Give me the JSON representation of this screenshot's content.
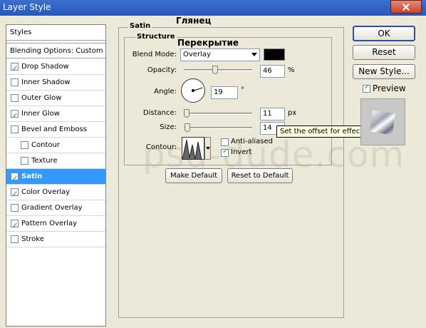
{
  "window": {
    "title": "Layer Style"
  },
  "sidebar": {
    "styles_header": "Styles",
    "blending_options": "Blending Options: Custom",
    "items": [
      {
        "label": "Drop Shadow",
        "checked": true,
        "sub": false,
        "selected": false
      },
      {
        "label": "Inner Shadow",
        "checked": false,
        "sub": false,
        "selected": false
      },
      {
        "label": "Outer Glow",
        "checked": false,
        "sub": false,
        "selected": false
      },
      {
        "label": "Inner Glow",
        "checked": true,
        "sub": false,
        "selected": false
      },
      {
        "label": "Bevel and Emboss",
        "checked": false,
        "sub": false,
        "selected": false
      },
      {
        "label": "Contour",
        "checked": false,
        "sub": true,
        "selected": false
      },
      {
        "label": "Texture",
        "checked": false,
        "sub": true,
        "selected": false
      },
      {
        "label": "Satin",
        "checked": true,
        "sub": false,
        "selected": true
      },
      {
        "label": "Color Overlay",
        "checked": true,
        "sub": false,
        "selected": false
      },
      {
        "label": "Gradient Overlay",
        "checked": false,
        "sub": false,
        "selected": false
      },
      {
        "label": "Pattern Overlay",
        "checked": true,
        "sub": false,
        "selected": false
      },
      {
        "label": "Stroke",
        "checked": false,
        "sub": false,
        "selected": false
      }
    ]
  },
  "satin": {
    "group_label": "Satin",
    "group_label_ru": "Глянец",
    "structure_label": "Structure",
    "structure_label_ru": "Перекрытие",
    "blend_mode_label": "Blend Mode:",
    "blend_mode_value": "Overlay",
    "blend_color": "#000000",
    "opacity_label": "Opacity:",
    "opacity_value": "46",
    "opacity_unit": "%",
    "angle_label": "Angle:",
    "angle_value": "19",
    "angle_unit": "°",
    "distance_label": "Distance:",
    "distance_value": "11",
    "distance_unit": "px",
    "size_label": "Size:",
    "size_value": "14",
    "contour_label": "Contour:",
    "anti_aliased_label": "Anti-aliased",
    "anti_aliased_checked": false,
    "invert_label": "Invert",
    "invert_checked": true,
    "tooltip": "Set the offset for effect",
    "make_default_label": "Make Default",
    "reset_default_label": "Reset to Default"
  },
  "buttons": {
    "ok": "OK",
    "reset": "Reset",
    "new_style": "New Style...",
    "preview_label": "Preview",
    "preview_checked": true
  },
  "watermark": "psd-dude.com"
}
